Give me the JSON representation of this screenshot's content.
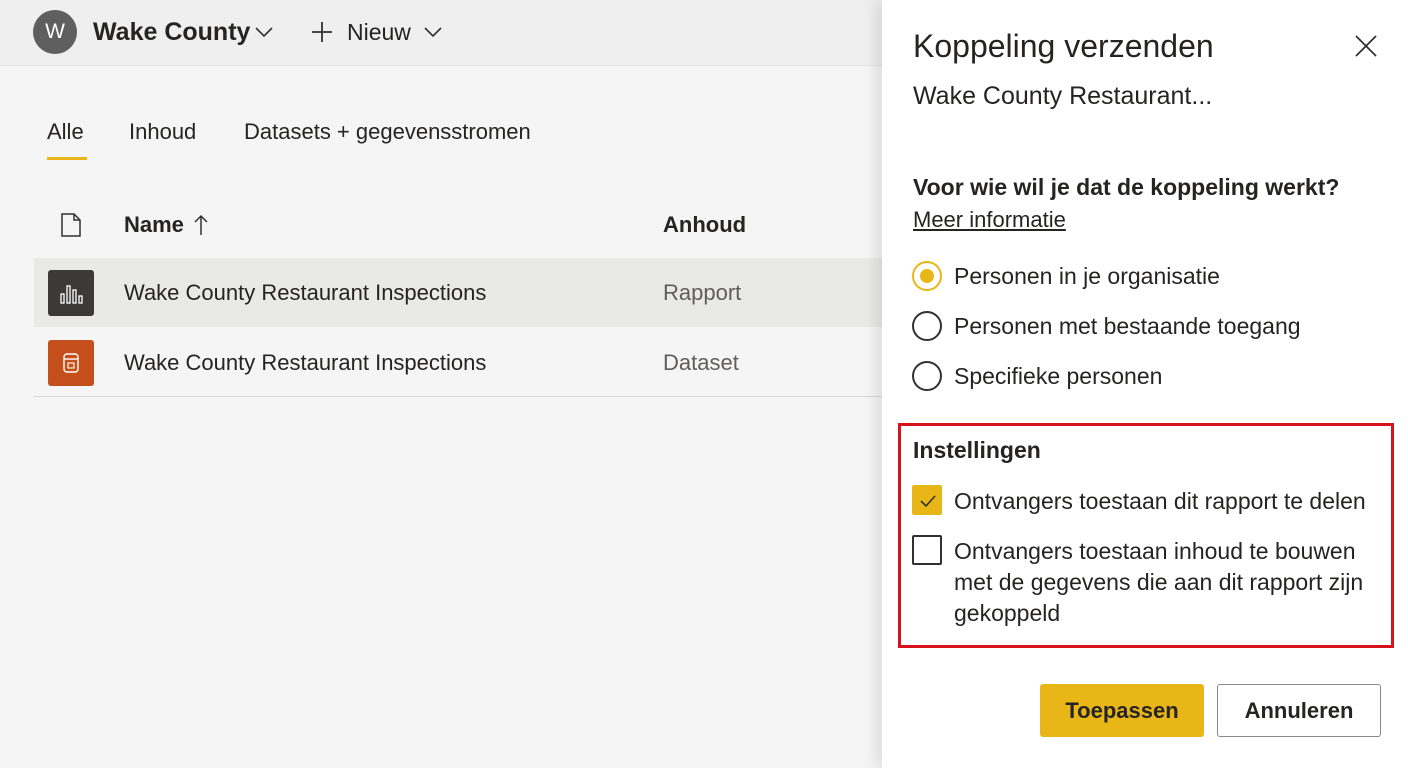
{
  "workspace": {
    "avatar_letter": "W",
    "name": "Wake County",
    "new_label": "Nieuw"
  },
  "tabs": [
    {
      "label": "Alle",
      "active": true
    },
    {
      "label": "Inhoud",
      "active": false
    },
    {
      "label": "Datasets + gegevensstromen",
      "active": false
    }
  ],
  "table": {
    "columns": {
      "name": "Name",
      "type": "Anhoud"
    },
    "sort_icon": "arrow-up-icon",
    "rows": [
      {
        "name": "Wake County Restaurant Inspections",
        "type": "Rapport",
        "icon": "report-chart-icon",
        "icon_color": "#3b3a39",
        "selected": true
      },
      {
        "name": "Wake County Restaurant Inspections",
        "type": "Dataset",
        "icon": "dataset-icon",
        "icon_color": "#c54f1a",
        "selected": false
      }
    ]
  },
  "share_panel": {
    "title": "Koppeling verzenden",
    "subtitle": "Wake County Restaurant...",
    "question": "Voor wie wil je dat de koppeling werkt?",
    "more_info": "Meer informatie",
    "options": [
      {
        "label": "Personen in je organisatie",
        "selected": true
      },
      {
        "label": "Personen met bestaande toegang",
        "selected": false
      },
      {
        "label": "Specifieke personen",
        "selected": false
      }
    ],
    "settings": {
      "title": "Instellingen",
      "checkboxes": [
        {
          "lines": [
            "Ontvangers toestaan dit rapport te delen"
          ],
          "checked": true
        },
        {
          "lines": [
            "Ontvangers toestaan inhoud te bouwen",
            "met de gegevens die aan dit rapport zijn",
            "gekoppeld"
          ],
          "checked": false
        }
      ]
    },
    "apply_label": "Toepassen",
    "cancel_label": "Annuleren"
  },
  "colors": {
    "accent": "#e8b717",
    "highlight_border": "#d6121b",
    "report_icon": "#3b3a39",
    "dataset_icon": "#c54f1a"
  }
}
